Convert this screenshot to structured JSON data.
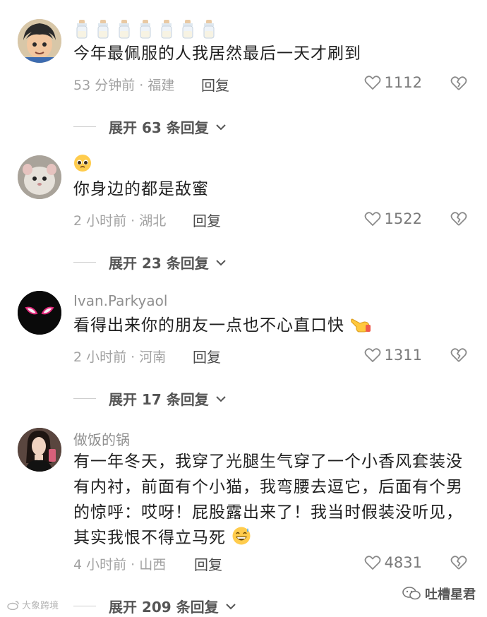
{
  "comments": [
    {
      "name": "",
      "text": "今年最佩服的人我居然最后一天才刷到",
      "time": "53 分钟前 · 福建",
      "reply_label": "回复",
      "likes": "1112",
      "expand_label": "展开 63 条回复",
      "prefix_emoji": "baby-bottle-icon x7"
    },
    {
      "name": "",
      "text": "你身边的都是敌蜜",
      "time": "2 小时前 · 湖北",
      "reply_label": "回复",
      "likes": "1522",
      "expand_label": "展开 23 条回复",
      "prefix_emoji": "pleading-face-icon"
    },
    {
      "name": "Ivan.Parkyaol",
      "text": "看得出来你的朋友一点也不心直口快",
      "time": "2 小时前 · 河南",
      "reply_label": "回复",
      "likes": "1311",
      "expand_label": "展开 17 条回复",
      "suffix_emoji": "pointing-hand-icon"
    },
    {
      "name": "做饭的锅",
      "text": "有一年冬天，我穿了光腿生气穿了一个小香风套装没有内衬，前面有个小猫，我弯腰去逗它，后面有个男的惊呼：哎呀！屁股露出来了！我当时假装没听见，其实我恨不得立马死",
      "time": "4 小时前 · 山西",
      "reply_label": "回复",
      "likes": "4831",
      "expand_label": "展开 209 条回复",
      "suffix_emoji": "sweat-smile-icon"
    }
  ],
  "watermark_left": "大象跨境",
  "watermark_right": "吐槽星君",
  "colors": {
    "text": "#1f1f1f",
    "meta": "#a2a2a2",
    "expand": "#555555"
  }
}
